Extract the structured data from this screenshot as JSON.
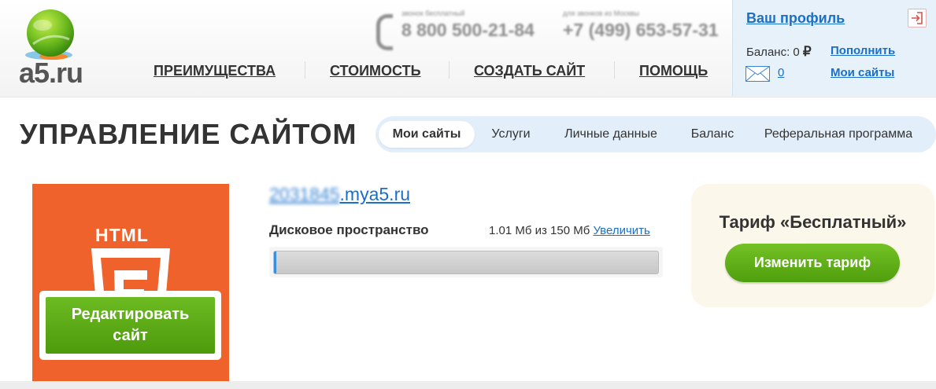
{
  "logo": {
    "text": "a5.ru"
  },
  "header": {
    "phones": [
      {
        "caption": "звонок бесплатный",
        "number": "8 800 500-21-84"
      },
      {
        "caption": "для звонков из Москвы",
        "number": "+7 (499) 653-57-31"
      }
    ],
    "nav": [
      "ПРЕИМУЩЕСТВА",
      "СТОИМОСТЬ",
      "СОЗДАТЬ САЙТ",
      "ПОМОЩЬ"
    ]
  },
  "profile": {
    "title": "Ваш профиль",
    "balance_label": "Баланс: 0",
    "currency": "₽",
    "topup": "Пополнить",
    "messages_count": "0",
    "my_sites": "Мои сайты"
  },
  "page": {
    "title": "УПРАВЛЕНИЕ САЙТОМ",
    "tabs": [
      "Мои сайты",
      "Услуги",
      "Личные данные",
      "Баланс",
      "Реферальная программа"
    ],
    "active_tab": "Мои сайты"
  },
  "site": {
    "template_label": "HTML",
    "edit_button": [
      "Редактировать",
      "сайт"
    ],
    "domain_id": "2031845",
    "domain_suffix": ".mya5.ru",
    "disk_label": "Дисковое пространство",
    "disk_usage": "1.01 Мб из 150 Мб",
    "increase_link": "Увеличить",
    "disk_used_fraction": 0.0067
  },
  "tariff": {
    "title": "Тариф «Бесплатный»",
    "change_button": "Изменить тариф"
  },
  "colors": {
    "accent_blue": "#1a6fc9",
    "green": "#5aa815",
    "orange": "#f0622c",
    "profile_bg": "#e7f1fa",
    "tabs_bg": "#e2effa"
  }
}
